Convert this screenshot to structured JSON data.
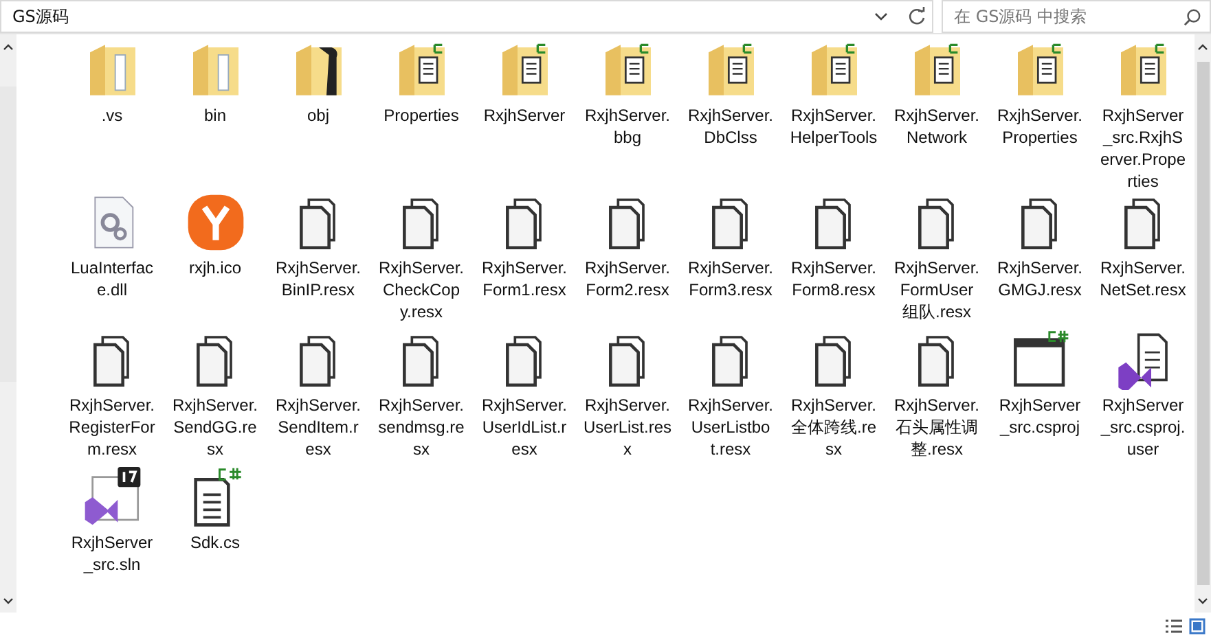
{
  "address_bar": {
    "path": "GS源码"
  },
  "search": {
    "placeholder": "在 GS源码 中搜索"
  },
  "files": [
    {
      "name": ".vs",
      "kind": "folder"
    },
    {
      "name": "bin",
      "kind": "folder"
    },
    {
      "name": "obj",
      "kind": "folder-dark"
    },
    {
      "name": "Properties",
      "kind": "folder-cs"
    },
    {
      "name": "RxjhServer",
      "kind": "folder-cs"
    },
    {
      "name": "RxjhServer.bbg",
      "kind": "folder-cs"
    },
    {
      "name": "RxjhServer.DbClss",
      "kind": "folder-cs"
    },
    {
      "name": "RxjhServer.HelperTools",
      "kind": "folder-cs"
    },
    {
      "name": "RxjhServer.Network",
      "kind": "folder-cs"
    },
    {
      "name": "RxjhServer.Properties",
      "kind": "folder-cs"
    },
    {
      "name": "RxjhServer_src.RxjhServer.Properties",
      "kind": "folder-cs"
    },
    {
      "name": "LuaInterface.dll",
      "kind": "dll"
    },
    {
      "name": "rxjh.ico",
      "kind": "ico"
    },
    {
      "name": "RxjhServer.BinIP.resx",
      "kind": "file"
    },
    {
      "name": "RxjhServer.CheckCopy.resx",
      "kind": "file"
    },
    {
      "name": "RxjhServer.Form1.resx",
      "kind": "file"
    },
    {
      "name": "RxjhServer.Form2.resx",
      "kind": "file"
    },
    {
      "name": "RxjhServer.Form3.resx",
      "kind": "file"
    },
    {
      "name": "RxjhServer.Form8.resx",
      "kind": "file"
    },
    {
      "name": "RxjhServer.FormUser组队.resx",
      "kind": "file"
    },
    {
      "name": "RxjhServer.GMGJ.resx",
      "kind": "file"
    },
    {
      "name": "RxjhServer.NetSet.resx",
      "kind": "file"
    },
    {
      "name": "RxjhServer.RegisterForm.resx",
      "kind": "file"
    },
    {
      "name": "RxjhServer.SendGG.resx",
      "kind": "file"
    },
    {
      "name": "RxjhServer.SendItem.resx",
      "kind": "file"
    },
    {
      "name": "RxjhServer.sendmsg.resx",
      "kind": "file"
    },
    {
      "name": "RxjhServer.UserIdList.resx",
      "kind": "file"
    },
    {
      "name": "RxjhServer.UserList.resx",
      "kind": "file"
    },
    {
      "name": "RxjhServer.UserListbot.resx",
      "kind": "file"
    },
    {
      "name": "RxjhServer.全体跨线.resx",
      "kind": "file"
    },
    {
      "name": "RxjhServer.石头属性调整.resx",
      "kind": "file"
    },
    {
      "name": "RxjhServer_src.csproj",
      "kind": "csproj"
    },
    {
      "name": "RxjhServer_src.csproj.user",
      "kind": "csproj-user"
    },
    {
      "name": "RxjhServer_src.sln",
      "kind": "sln"
    },
    {
      "name": "Sdk.cs",
      "kind": "cs"
    }
  ]
}
